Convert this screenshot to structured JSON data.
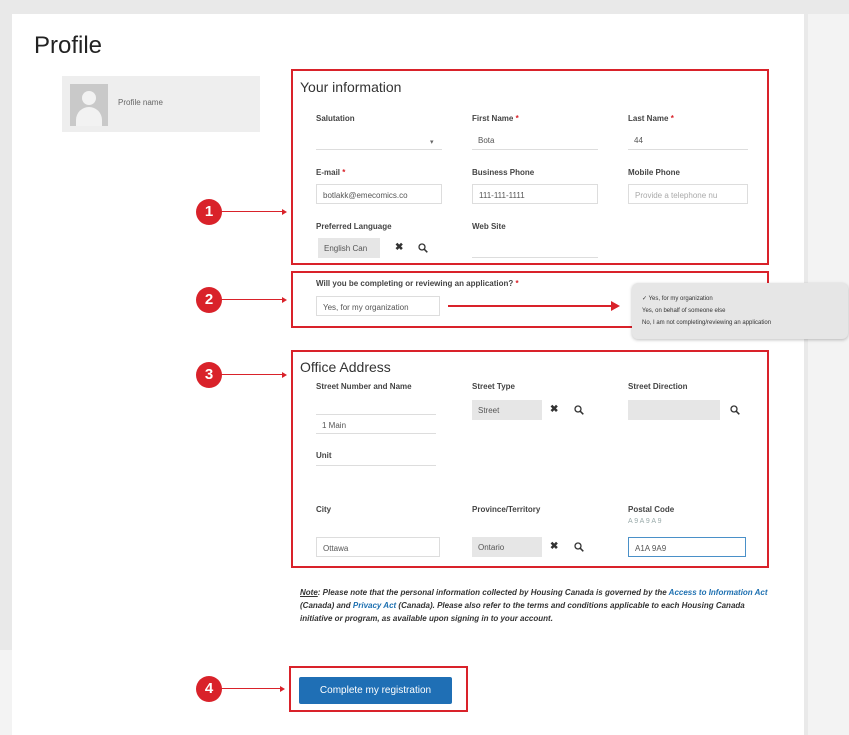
{
  "page": {
    "title": "Profile"
  },
  "profile": {
    "name": "Profile name"
  },
  "your_information": {
    "title": "Your information",
    "salutation": {
      "label": "Salutation",
      "value": ""
    },
    "first_name": {
      "label": "First Name",
      "value": "Bota",
      "required_mark": "*"
    },
    "last_name": {
      "label": "Last Name",
      "value": "44",
      "required_mark": "*"
    },
    "email": {
      "label": "E-mail",
      "value": "botlakk@emecomics.co",
      "required_mark": "*"
    },
    "business_phone": {
      "label": "Business Phone",
      "value": "111-111-1111"
    },
    "mobile_phone": {
      "label": "Mobile Phone",
      "placeholder": "Provide a telephone nu"
    },
    "preferred_language": {
      "label": "Preferred Language",
      "value": "English Can"
    },
    "web_site": {
      "label": "Web Site",
      "value": ""
    }
  },
  "application_question": {
    "label": "Will you be completing or reviewing an application?",
    "required_mark": "*",
    "value": "Yes, for my organization",
    "options": [
      "✓ Yes, for my organization",
      "Yes, on behalf of someone else",
      "No, I am not completing/reviewing an application"
    ]
  },
  "office_address": {
    "title": "Office Address",
    "street_number_name": {
      "label": "Street Number and Name",
      "value": "1 Main"
    },
    "street_type": {
      "label": "Street Type",
      "value": "Street"
    },
    "street_direction": {
      "label": "Street Direction",
      "value": ""
    },
    "unit": {
      "label": "Unit",
      "value": ""
    },
    "city": {
      "label": "City",
      "value": "Ottawa"
    },
    "province": {
      "label": "Province/Territory",
      "value": "Ontario"
    },
    "postal_code": {
      "label": "Postal Code",
      "hint": "A 9 A 9 A 9",
      "value": "A1A 9A9"
    }
  },
  "note": {
    "prefix": "Note",
    "text1": ": Please note that the personal information collected by Housing Canada is governed by the ",
    "link1": "Access to Information Act",
    "text2": " (Canada) and ",
    "link2": "Privacy Act",
    "text3": " (Canada). Please also refer to the terms and conditions applicable to each Housing Canada initiative or program, as available upon signing in to your account."
  },
  "submit": {
    "label": "Complete my registration"
  },
  "callouts": [
    "1",
    "2",
    "3",
    "4"
  ],
  "colors": {
    "callout_red": "#d9222a",
    "button_blue": "#1f6fb5",
    "link_blue": "#1c6fb0"
  },
  "icons": {
    "clear": "close-x-icon",
    "search": "magnifier-icon",
    "user": "user-silhouette-icon"
  }
}
